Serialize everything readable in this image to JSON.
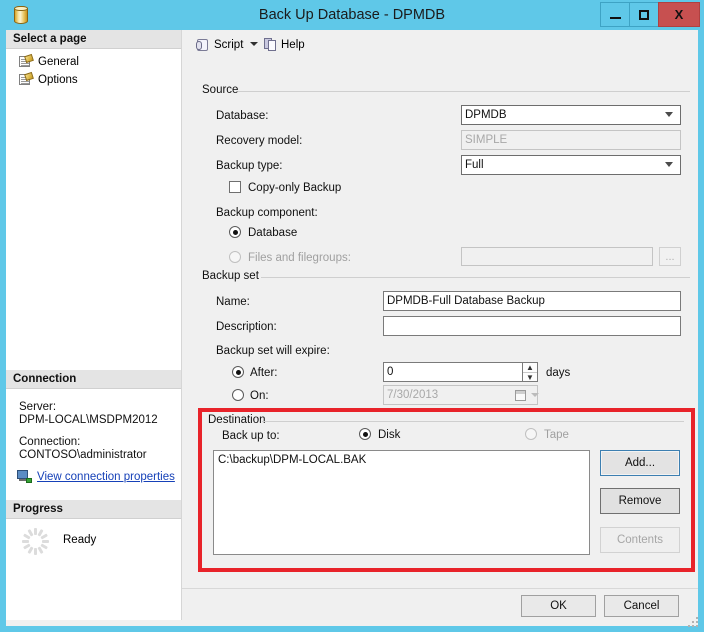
{
  "window": {
    "title": "Back Up Database - DPMDB",
    "icon": "database-cylinder-icon",
    "minimize_label": "",
    "maximize_label": "",
    "close_label": "X"
  },
  "toolbar": {
    "script_label": "Script",
    "script_icon": "script-icon",
    "dropdown_icon": "chevron-down-icon",
    "help_label": "Help",
    "help_icon": "help-icon"
  },
  "sidebar": {
    "select_page_header": "Select a page",
    "pages": [
      {
        "label": "General",
        "icon": "page-icon"
      },
      {
        "label": "Options",
        "icon": "page-icon"
      }
    ],
    "connection_header": "Connection",
    "server_label": "Server:",
    "server_value": "DPM-LOCAL\\MSDPM2012",
    "connection_label": "Connection:",
    "connection_value": "CONTOSO\\administrator",
    "view_connection_link": "View connection properties",
    "view_connection_icon": "network-computer-icon",
    "progress_header": "Progress",
    "progress_status": "Ready",
    "progress_icon": "spinner-icon"
  },
  "source": {
    "group_label": "Source",
    "database_label": "Database:",
    "database_value": "DPMDB",
    "recovery_model_label": "Recovery model:",
    "recovery_model_value": "SIMPLE",
    "backup_type_label": "Backup type:",
    "backup_type_value": "Full",
    "copy_only_label": "Copy-only Backup",
    "copy_only_checked": false,
    "backup_component_label": "Backup component:",
    "component_database_label": "Database",
    "component_database_selected": true,
    "component_files_label": "Files and filegroups:",
    "component_files_selected": false,
    "component_files_value": "",
    "files_browse_label": "..."
  },
  "backup_set": {
    "group_label": "Backup set",
    "name_label": "Name:",
    "name_value": "DPMDB-Full Database Backup",
    "description_label": "Description:",
    "description_value": "",
    "expire_label": "Backup set will expire:",
    "after_label": "After:",
    "after_selected": true,
    "after_value": "0",
    "days_label": "days",
    "on_label": "On:",
    "on_selected": false,
    "on_value": "7/30/2013",
    "calendar_icon": "calendar-icon"
  },
  "destination": {
    "group_label": "Destination",
    "back_up_to_label": "Back up to:",
    "disk_label": "Disk",
    "disk_selected": true,
    "tape_label": "Tape",
    "tape_selected": false,
    "tape_disabled": true,
    "paths": [
      "C:\\backup\\DPM-LOCAL.BAK"
    ],
    "add_button": "Add...",
    "remove_button": "Remove",
    "contents_button": "Contents",
    "contents_disabled": true
  },
  "footer": {
    "ok_label": "OK",
    "cancel_label": "Cancel"
  },
  "colors": {
    "titlebar": "#5fc8e8",
    "close_button": "#c75050",
    "highlight_box": "#e8232a",
    "link": "#1641b8",
    "dialog_bg": "#f0f0f0"
  }
}
